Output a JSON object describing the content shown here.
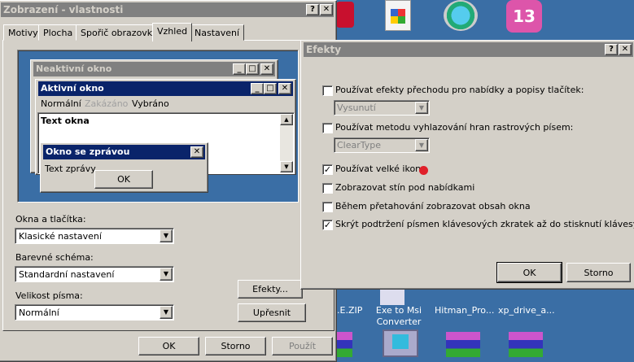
{
  "display_dialog": {
    "title": "Zobrazení - vlastnosti",
    "tabs": [
      "Motivy",
      "Plocha",
      "Spořič obrazovky",
      "Vzhled",
      "Nastavení"
    ],
    "active_tab": "Vzhled",
    "preview": {
      "inactive_title": "Neaktivní okno",
      "active_title": "Aktivní okno",
      "menu": [
        "Normální",
        "Zakázáno",
        "Vybráno"
      ],
      "window_text": "Text okna",
      "msg_title": "Okno se zprávou",
      "msg_text": "Text zprávy",
      "msg_ok": "OK"
    },
    "windows_buttons_label": "Okna a tlačítka:",
    "windows_buttons_value": "Klasické nastavení",
    "color_scheme_label": "Barevné schéma:",
    "color_scheme_value": "Standardní nastavení",
    "font_size_label": "Velikost písma:",
    "font_size_value": "Normální",
    "effects_button": "Efekty...",
    "advanced_button": "Upřesnit",
    "ok": "OK",
    "cancel": "Storno",
    "apply": "Použít"
  },
  "effects_dialog": {
    "title": "Efekty",
    "options": [
      {
        "label": "Používat efekty přechodu pro nabídky a popisy tlačítek:",
        "checked": false
      },
      {
        "label": "Používat metodu vyhlazování hran rastrových písem:",
        "checked": false
      },
      {
        "label": "Používat velké ikony",
        "checked": true
      },
      {
        "label": "Zobrazovat stín pod nabídkami",
        "checked": false
      },
      {
        "label": "Během přetahování zobrazovat obsah okna",
        "checked": false
      },
      {
        "label": "Skrýt podtržení písmen klávesových zkratek až do stisknutí klávesy Alt",
        "checked": true
      }
    ],
    "transition_value": "Vysunutí",
    "smoothing_value": "ClearType",
    "ok": "OK",
    "cancel": "Storno"
  },
  "desktop": {
    "icons": [
      ".E.ZIP",
      "Exe to Msi Converter",
      "Hitman_Pro...",
      "xp_drive_a..."
    ]
  },
  "colors": {
    "desktop": "#3a6ea5",
    "active_title": "#0a246a",
    "inactive_title": "#808080",
    "face": "#d4d0c8"
  }
}
